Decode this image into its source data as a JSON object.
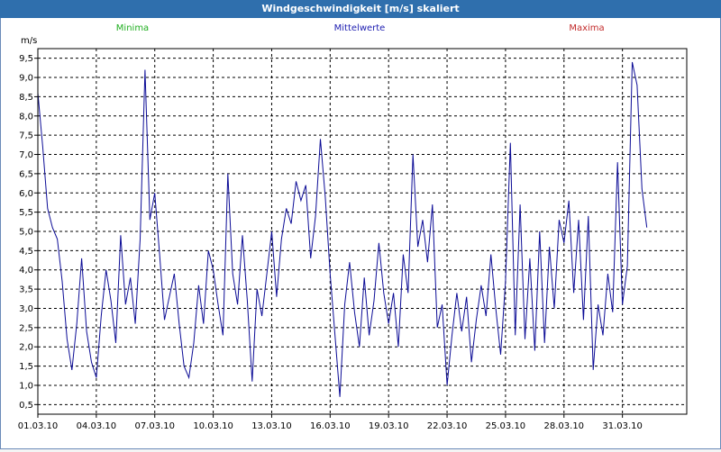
{
  "window": {
    "title": "Windgeschwindigkeit [m/s] skaliert"
  },
  "legend": [
    {
      "label": "Minima",
      "color": "#1fae1f"
    },
    {
      "label": "Mittelwerte",
      "color": "#1c1cb0"
    },
    {
      "label": "Maxima",
      "color": "#c22a2a"
    }
  ],
  "colors": {
    "line": "#0c0c96",
    "grid": "#000000",
    "axis": "#000000",
    "background": "#ffffff"
  },
  "chart_data": {
    "type": "line",
    "ylabel": "m/s",
    "ylim": [
      0.25,
      9.75
    ],
    "yticks": [
      "0,5",
      "1,0",
      "1,5",
      "2,0",
      "2,5",
      "3,0",
      "3,5",
      "4,0",
      "4,5",
      "5,0",
      "5,5",
      "6,0",
      "6,5",
      "7,0",
      "7,5",
      "8,0",
      "8,5",
      "9,0",
      "9,5"
    ],
    "xlim_days": [
      0,
      33.3
    ],
    "xticks": [
      "01.03.10",
      "04.03.10",
      "07.03.10",
      "10.03.10",
      "13.03.10",
      "16.03.10",
      "19.03.10",
      "22.03.10",
      "25.03.10",
      "28.03.10",
      "31.03.10"
    ],
    "grid": true,
    "series": [
      {
        "name": "Mittelwerte",
        "points": [
          [
            "01.03.10",
            8.6
          ],
          [
            "01.03.10 06h",
            7.2
          ],
          [
            "01.03.10 12h",
            5.6
          ],
          [
            "01.03.10 18h",
            5.1
          ],
          [
            "02.03.10",
            4.8
          ],
          [
            "02.03.10 06h",
            3.7
          ],
          [
            "02.03.10 12h",
            2.2
          ],
          [
            "02.03.10 18h",
            1.4
          ],
          [
            "03.03.10",
            2.6
          ],
          [
            "03.03.10 06h",
            4.3
          ],
          [
            "03.03.10 12h",
            2.4
          ],
          [
            "03.03.10 18h",
            1.6
          ],
          [
            "04.03.10",
            1.2
          ],
          [
            "04.03.10 06h",
            2.8
          ],
          [
            "04.03.10 12h",
            4.0
          ],
          [
            "04.03.10 18h",
            3.2
          ],
          [
            "05.03.10",
            2.1
          ],
          [
            "05.03.10 06h",
            4.9
          ],
          [
            "05.03.10 12h",
            3.1
          ],
          [
            "05.03.10 18h",
            3.8
          ],
          [
            "06.03.10",
            2.6
          ],
          [
            "06.03.10 06h",
            4.8
          ],
          [
            "06.03.10 12h",
            9.2
          ],
          [
            "06.03.10 18h",
            5.3
          ],
          [
            "07.03.10",
            6.0
          ],
          [
            "07.03.10 06h",
            4.4
          ],
          [
            "07.03.10 12h",
            2.7
          ],
          [
            "07.03.10 18h",
            3.3
          ],
          [
            "08.03.10",
            3.9
          ],
          [
            "08.03.10 06h",
            2.6
          ],
          [
            "08.03.10 12h",
            1.5
          ],
          [
            "08.03.10 18h",
            1.2
          ],
          [
            "09.03.10",
            2.1
          ],
          [
            "09.03.10 06h",
            3.6
          ],
          [
            "09.03.10 12h",
            2.6
          ],
          [
            "09.03.10 18h",
            4.5
          ],
          [
            "10.03.10",
            4.0
          ],
          [
            "10.03.10 06h",
            3.1
          ],
          [
            "10.03.10 12h",
            2.3
          ],
          [
            "10.03.10 18h",
            6.5
          ],
          [
            "11.03.10",
            3.9
          ],
          [
            "11.03.10 06h",
            3.1
          ],
          [
            "11.03.10 12h",
            4.9
          ],
          [
            "11.03.10 18h",
            3.2
          ],
          [
            "12.03.10",
            1.1
          ],
          [
            "12.03.10 06h",
            3.5
          ],
          [
            "12.03.10 12h",
            2.8
          ],
          [
            "12.03.10 18h",
            3.9
          ],
          [
            "13.03.10",
            5.0
          ],
          [
            "13.03.10 06h",
            3.3
          ],
          [
            "13.03.10 12h",
            4.8
          ],
          [
            "13.03.10 18h",
            5.6
          ],
          [
            "14.03.10",
            5.2
          ],
          [
            "14.03.10 06h",
            6.3
          ],
          [
            "14.03.10 12h",
            5.8
          ],
          [
            "14.03.10 18h",
            6.2
          ],
          [
            "15.03.10",
            4.3
          ],
          [
            "15.03.10 06h",
            5.4
          ],
          [
            "15.03.10 12h",
            7.4
          ],
          [
            "15.03.10 18h",
            5.9
          ],
          [
            "16.03.10",
            3.9
          ],
          [
            "16.03.10 06h",
            2.3
          ],
          [
            "16.03.10 12h",
            0.7
          ],
          [
            "16.03.10 18h",
            3.1
          ],
          [
            "17.03.10",
            4.2
          ],
          [
            "17.03.10 06h",
            2.9
          ],
          [
            "17.03.10 12h",
            2.0
          ],
          [
            "17.03.10 18h",
            3.8
          ],
          [
            "18.03.10",
            2.3
          ],
          [
            "18.03.10 06h",
            3.2
          ],
          [
            "18.03.10 12h",
            4.7
          ],
          [
            "18.03.10 18h",
            3.4
          ],
          [
            "19.03.10",
            2.6
          ],
          [
            "19.03.10 06h",
            3.4
          ],
          [
            "19.03.10 12h",
            2.0
          ],
          [
            "19.03.10 18h",
            4.4
          ],
          [
            "20.03.10",
            3.4
          ],
          [
            "20.03.10 06h",
            7.0
          ],
          [
            "20.03.10 12h",
            4.6
          ],
          [
            "20.03.10 18h",
            5.3
          ],
          [
            "21.03.10",
            4.2
          ],
          [
            "21.03.10 06h",
            5.7
          ],
          [
            "21.03.10 12h",
            2.5
          ],
          [
            "21.03.10 18h",
            3.1
          ],
          [
            "22.03.10",
            1.0
          ],
          [
            "22.03.10 06h",
            2.3
          ],
          [
            "22.03.10 12h",
            3.4
          ],
          [
            "22.03.10 18h",
            2.4
          ],
          [
            "23.03.10",
            3.3
          ],
          [
            "23.03.10 06h",
            1.6
          ],
          [
            "23.03.10 12h",
            2.7
          ],
          [
            "23.03.10 18h",
            3.6
          ],
          [
            "24.03.10",
            2.8
          ],
          [
            "24.03.10 06h",
            4.4
          ],
          [
            "24.03.10 12h",
            3.0
          ],
          [
            "24.03.10 18h",
            1.8
          ],
          [
            "25.03.10",
            3.7
          ],
          [
            "25.03.10 06h",
            7.3
          ],
          [
            "25.03.10 12h",
            2.3
          ],
          [
            "25.03.10 18h",
            5.7
          ],
          [
            "26.03.10",
            2.2
          ],
          [
            "26.03.10 06h",
            4.3
          ],
          [
            "26.03.10 12h",
            1.9
          ],
          [
            "26.03.10 18h",
            5.0
          ],
          [
            "27.03.10",
            2.1
          ],
          [
            "27.03.10 06h",
            4.6
          ],
          [
            "27.03.10 12h",
            3.0
          ],
          [
            "27.03.10 18h",
            5.3
          ],
          [
            "28.03.10",
            4.7
          ],
          [
            "28.03.10 06h",
            5.8
          ],
          [
            "28.03.10 12h",
            3.4
          ],
          [
            "28.03.10 18h",
            5.3
          ],
          [
            "29.03.10",
            2.7
          ],
          [
            "29.03.10 06h",
            5.4
          ],
          [
            "29.03.10 12h",
            1.4
          ],
          [
            "29.03.10 18h",
            3.1
          ],
          [
            "30.03.10",
            2.3
          ],
          [
            "30.03.10 06h",
            3.9
          ],
          [
            "30.03.10 12h",
            2.9
          ],
          [
            "30.03.10 18h",
            6.8
          ],
          [
            "31.03.10",
            3.1
          ],
          [
            "31.03.10 06h",
            4.1
          ],
          [
            "31.03.10 12h",
            9.4
          ],
          [
            "31.03.10 18h",
            8.8
          ],
          [
            "01.04.10",
            6.1
          ],
          [
            "01.04.10 06h",
            5.1
          ]
        ]
      }
    ]
  }
}
